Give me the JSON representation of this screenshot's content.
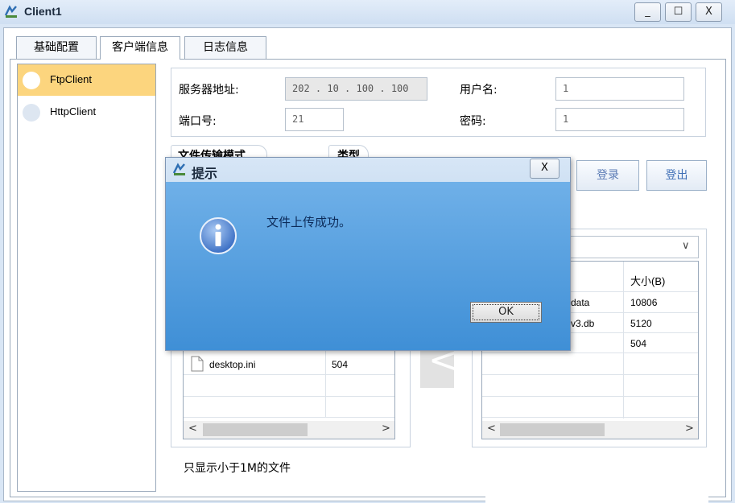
{
  "window": {
    "title": "Client1",
    "minimize": "_",
    "maximize": "☐",
    "close": "X"
  },
  "tabs": [
    {
      "label": "基础配置"
    },
    {
      "label": "客户端信息"
    },
    {
      "label": "日志信息"
    }
  ],
  "sidebar": {
    "items": [
      {
        "label": "FtpClient"
      },
      {
        "label": "HttpClient"
      }
    ]
  },
  "form": {
    "server_label": "服务器地址:",
    "server_value": "202 . 10 . 100 . 100",
    "user_label": "用户名:",
    "user_value": "1",
    "port_label": "端口号:",
    "port_value": "21",
    "password_label": "密码:",
    "password_value": "1",
    "transfer_mode_label": "文件传输模式",
    "type_label": "类型",
    "login_label": "登录",
    "logout_label": "登出"
  },
  "local_list": {
    "rows": [
      {
        "name": "desktop.ini",
        "size": "504"
      }
    ],
    "scroll_left": "<",
    "scroll_right": ">"
  },
  "remote_list": {
    "dropdown_arrow": "∨",
    "header_size": "大小(B)",
    "rows": [
      {
        "name": "data",
        "size": "10806"
      },
      {
        "name": "v3.db",
        "size": "5120"
      },
      {
        "name": "",
        "size": "504"
      }
    ],
    "scroll_left": "<",
    "scroll_right": ">"
  },
  "transfer_arrow": "<",
  "footer_note": "只显示小于1M的文件",
  "dialog": {
    "title": "提示",
    "close": "X",
    "message": "文件上传成功。",
    "ok_label": "OK",
    "icon": "info-icon"
  }
}
